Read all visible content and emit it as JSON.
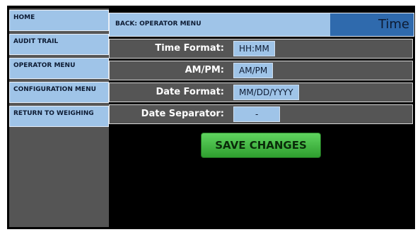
{
  "sidebar": {
    "items": [
      {
        "label": "HOME"
      },
      {
        "label": "AUDIT TRAIL"
      },
      {
        "label": "OPERATOR MENU"
      },
      {
        "label": "CONFIGURATION MENU"
      },
      {
        "label": "RETURN TO WEIGHING"
      }
    ]
  },
  "header": {
    "back_label": "BACK: OPERATOR MENU",
    "title": "Time"
  },
  "settings": [
    {
      "label": "Time Format:",
      "value": "HH:MM"
    },
    {
      "label": "AM/PM:",
      "value": "AM/PM"
    },
    {
      "label": "Date Format:",
      "value": "MM/DD/YYYY"
    },
    {
      "label": "Date Separator:",
      "value": "-"
    }
  ],
  "actions": {
    "save_label": "SAVE CHANGES"
  },
  "colors": {
    "accent_light": "#9fc4e8",
    "accent_dark": "#2f6aad",
    "panel_gray": "#555555",
    "save_green": "#3fb83f"
  }
}
